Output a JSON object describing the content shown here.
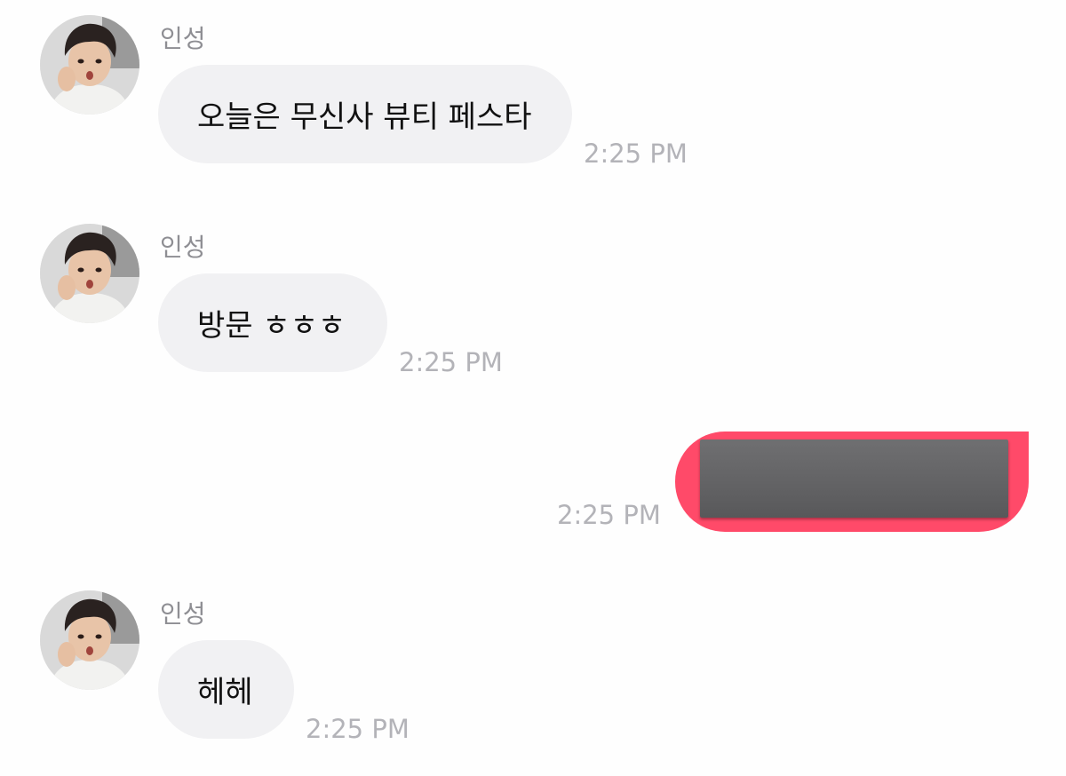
{
  "messages": [
    {
      "sender": "인성",
      "text": "오늘은 무신사 뷰티 페스타",
      "time": "2:25 PM"
    },
    {
      "sender": "인성",
      "text": "방문 ㅎㅎㅎ",
      "time": "2:25 PM"
    },
    {
      "time": "2:25 PM",
      "content": "redacted"
    },
    {
      "sender": "인성",
      "text": "헤헤",
      "time": "2:25 PM"
    }
  ],
  "colors": {
    "incoming_bubble": "#f1f1f3",
    "outgoing_bubble": "#ff4a69",
    "time_text": "#b3b3b8",
    "sender_text": "#8e8e93",
    "redaction": "#656567"
  },
  "icons": {
    "avatar": "profile-photo"
  }
}
